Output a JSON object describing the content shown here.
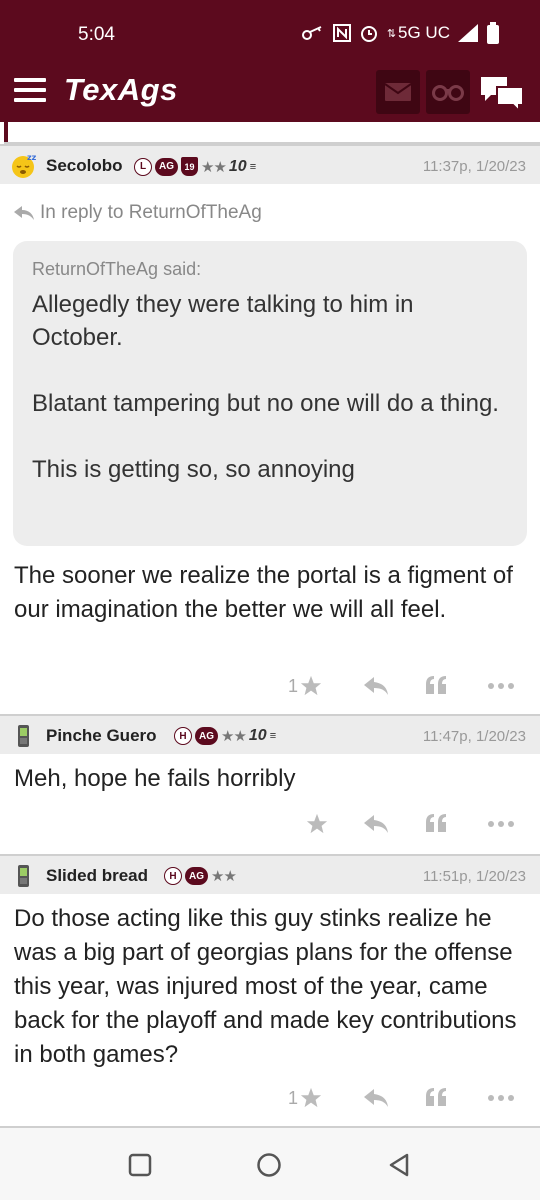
{
  "status_bar": {
    "time": "5:04",
    "network": "5G UC",
    "icons": [
      "key-icon",
      "nfc-icon",
      "alarm-icon",
      "data-arrows-icon",
      "signal-icon",
      "battery-icon"
    ]
  },
  "header": {
    "logo": "TexAgs",
    "icons": [
      "menu-icon",
      "mail-icon",
      "binoculars-icon",
      "chat-icon"
    ],
    "brand_color": "#5c0a1e"
  },
  "posts": [
    {
      "username": "Secolobo",
      "avatar": "sleeping-emoji-icon",
      "badges": [
        "L",
        "AG",
        "19"
      ],
      "stars": "★★",
      "level": "10",
      "timestamp": "11:37p, 1/20/23",
      "reply_to": "In reply to ReturnOfTheAg",
      "quote": {
        "author": "ReturnOfTheAg said:",
        "paragraphs": [
          "Allegedly they were talking to him in October.",
          "Blatant tampering but no one will do a thing.",
          "This is getting so, so annoying"
        ]
      },
      "body": "The sooner we realize the portal is a figment of our imagination the better we will all feel.",
      "like_count": "1"
    },
    {
      "username": "Pinche Guero",
      "avatar": "phone-icon",
      "badges": [
        "H",
        "AG"
      ],
      "stars": "★★",
      "level": "10",
      "timestamp": "11:47p, 1/20/23",
      "body": "Meh, hope he fails horribly",
      "like_count": ""
    },
    {
      "username": "Slided bread",
      "avatar": "phone-icon",
      "badges": [
        "H",
        "AG"
      ],
      "stars": "★★",
      "level": "",
      "timestamp": "11:51p, 1/20/23",
      "body": "Do those acting like this guy stinks realize he was a big part of georgias plans for the offense this year, was injured most of the year, came back for the playoff and made key contributions in both games?",
      "like_count": "1"
    }
  ],
  "nav_bar": {
    "buttons": [
      "recents-icon",
      "home-icon",
      "back-icon"
    ]
  }
}
